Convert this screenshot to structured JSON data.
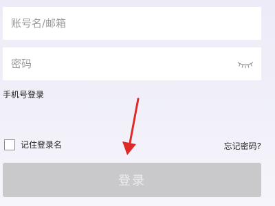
{
  "login_form": {
    "account_placeholder": "账号名/邮箱",
    "password_placeholder": "密码",
    "phone_login_link": "手机号登录",
    "remember_label": "记住登录名",
    "forgot_link": "忘记密码?",
    "login_button": "登录"
  },
  "icons": {
    "password_toggle": "eye-closed-icon",
    "annotation": "red-arrow-down"
  },
  "colors": {
    "background": "#eeedf8",
    "button_disabled": "#c9c9cc",
    "arrow": "#e02a2a"
  }
}
